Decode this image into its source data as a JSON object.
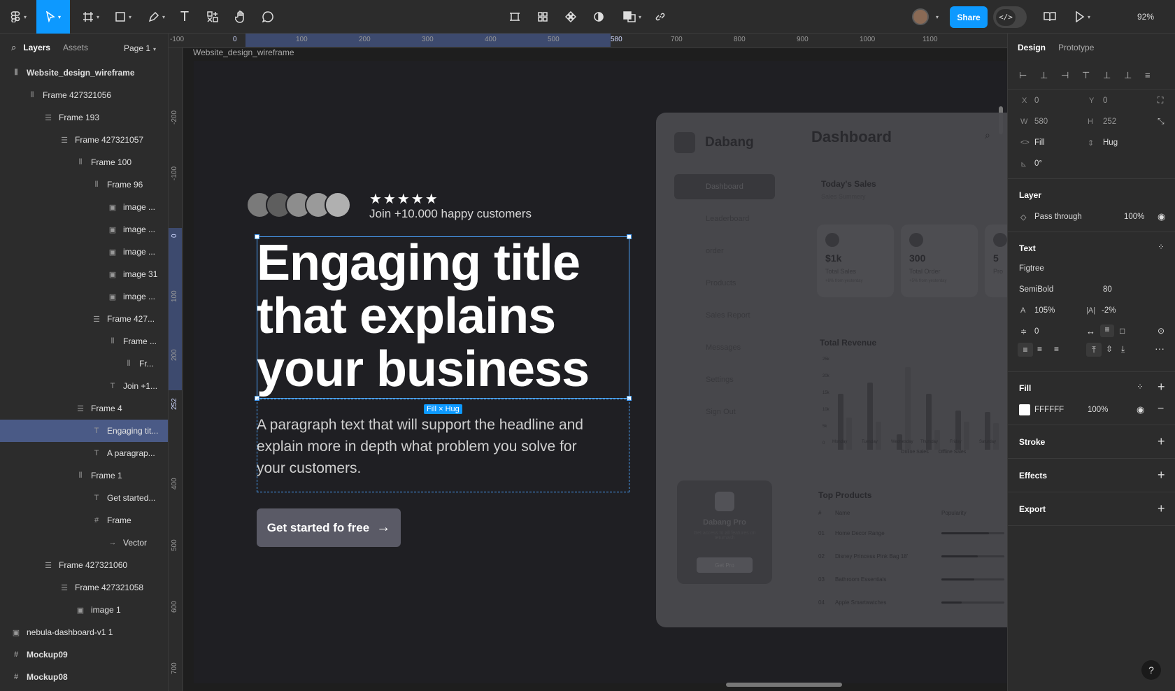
{
  "toolbar": {
    "share_label": "Share",
    "dev_mode_label": "</>",
    "zoom": "92%"
  },
  "left_panel": {
    "tabs": [
      "Layers",
      "Assets"
    ],
    "page": "Page 1",
    "layers": [
      {
        "name": "Website_design_wireframe",
        "indent": 0,
        "icon": "frame-vertical-icon",
        "bold": true
      },
      {
        "name": "Frame 427321056",
        "indent": 1,
        "icon": "frame-vertical-icon"
      },
      {
        "name": "Frame 193",
        "indent": 2,
        "icon": "frame-horizontal-icon"
      },
      {
        "name": "Frame 427321057",
        "indent": 3,
        "icon": "frame-horizontal-icon"
      },
      {
        "name": "Frame 100",
        "indent": 4,
        "icon": "frame-vertical-icon"
      },
      {
        "name": "Frame 96",
        "indent": 5,
        "icon": "frame-vertical-icon"
      },
      {
        "name": "image ...",
        "indent": 6,
        "icon": "image-icon"
      },
      {
        "name": "image ...",
        "indent": 6,
        "icon": "image-icon"
      },
      {
        "name": "image ...",
        "indent": 6,
        "icon": "image-icon"
      },
      {
        "name": "image 31",
        "indent": 6,
        "icon": "image-icon"
      },
      {
        "name": "image ...",
        "indent": 6,
        "icon": "image-icon"
      },
      {
        "name": "Frame 427...",
        "indent": 5,
        "icon": "frame-horizontal-icon"
      },
      {
        "name": "Frame ...",
        "indent": 6,
        "icon": "frame-vertical-icon"
      },
      {
        "name": "Fr...",
        "indent": 7,
        "icon": "frame-vertical-icon"
      },
      {
        "name": "Join +1...",
        "indent": 6,
        "icon": "text-icon"
      },
      {
        "name": "Frame 4",
        "indent": 4,
        "icon": "frame-horizontal-icon"
      },
      {
        "name": "Engaging tit...",
        "indent": 5,
        "icon": "text-icon",
        "selected": true
      },
      {
        "name": "A paragrap...",
        "indent": 5,
        "icon": "text-icon"
      },
      {
        "name": "Frame 1",
        "indent": 4,
        "icon": "frame-vertical-icon"
      },
      {
        "name": "Get started...",
        "indent": 5,
        "icon": "text-icon"
      },
      {
        "name": "Frame",
        "indent": 5,
        "icon": "hash-icon"
      },
      {
        "name": "Vector",
        "indent": 6,
        "icon": "arrow-icon"
      },
      {
        "name": "Frame 427321060",
        "indent": 2,
        "icon": "frame-horizontal-icon"
      },
      {
        "name": "Frame 427321058",
        "indent": 3,
        "icon": "frame-horizontal-icon"
      },
      {
        "name": "image 1",
        "indent": 4,
        "icon": "image-icon"
      },
      {
        "name": "nebula-dashboard-v1 1",
        "indent": 0,
        "icon": "image-icon"
      },
      {
        "name": "Mockup09",
        "indent": 0,
        "icon": "hash-icon",
        "bold": true
      },
      {
        "name": "Mockup08",
        "indent": 0,
        "icon": "hash-icon",
        "bold": true
      }
    ]
  },
  "rulers": {
    "top": [
      "-100",
      "0",
      "100",
      "200",
      "300",
      "400",
      "500",
      "580",
      "700",
      "800",
      "900",
      "1000",
      "1100"
    ],
    "left": [
      "-200",
      "-100",
      "0",
      "100",
      "200",
      "252",
      "400",
      "500",
      "600",
      "700"
    ]
  },
  "canvas": {
    "frame_name": "Website_design_wireframe",
    "stars": "★★★★★",
    "join_text": "Join +10.000 happy customers",
    "headline_lines": [
      "Engaging title",
      "that explains",
      "your business"
    ],
    "size_badge": "Fill × Hug",
    "paragraph": "A paragraph text that will support the headline and explain more in depth what problem you solve for your customers.",
    "cta_label": "Get started fo free",
    "cta_arrow": "→",
    "mockup": {
      "brand": "Dabang",
      "title": "Dashboard",
      "nav": [
        "Dashboard",
        "Leaderboard",
        "order",
        "Products",
        "Sales Report",
        "Messages",
        "Settings",
        "Sign Out"
      ],
      "todays_sales": "Today's Sales",
      "sales_summary": "Sales Summery",
      "cards": [
        {
          "value": "$1k",
          "label": "Total Sales",
          "sub": "+8% from yesterday"
        },
        {
          "value": "300",
          "label": "Total Order",
          "sub": "+5% from yesterday"
        },
        {
          "value": "5",
          "label": "Pro",
          "sub": ""
        }
      ],
      "total_revenue": "Total Revenue",
      "revenue_days": [
        "Monday",
        "Tuesday",
        "Wednesday",
        "Thursday",
        "Friday",
        "Saturday"
      ],
      "revenue_y_ticks": [
        "25k",
        "20k",
        "15k",
        "10k",
        "5k",
        "0"
      ],
      "revenue_legend": [
        "Online Sales",
        "Offline Sales"
      ],
      "promo_title": "Dabang Pro",
      "promo_text": "Get access to all features on tetumash",
      "promo_btn": "Get Pro",
      "top_products": "Top Products",
      "top_products_headers": [
        "#",
        "Name",
        "Popularity"
      ],
      "products": [
        {
          "n": "01",
          "name": "Home Decor Range"
        },
        {
          "n": "02",
          "name": "Disney Princess Pink Bag 18'"
        },
        {
          "n": "03",
          "name": "Bathroom Essentials"
        },
        {
          "n": "04",
          "name": "Apple Smartwatches"
        }
      ]
    }
  },
  "right_panel": {
    "tabs": [
      "Design",
      "Prototype"
    ],
    "position": {
      "x_label": "X",
      "x": "0",
      "y_label": "Y",
      "y": "0",
      "w_label": "W",
      "w": "580",
      "h_label": "H",
      "h": "252",
      "fill_mode": "Fill",
      "hug_mode": "Hug",
      "rotation": "0°"
    },
    "layer": {
      "title": "Layer",
      "blend": "Pass through",
      "opacity": "100%"
    },
    "text": {
      "title": "Text",
      "font": "Figtree",
      "weight": "SemiBold",
      "size": "80",
      "line_height": "105%",
      "letter_spacing": "-2%",
      "paragraph_spacing": "0"
    },
    "fill": {
      "title": "Fill",
      "color": "FFFFFF",
      "opacity": "100%",
      "swatch": "#FFFFFF"
    },
    "stroke_title": "Stroke",
    "effects_title": "Effects",
    "export_title": "Export"
  },
  "help_label": "?",
  "colors": {
    "accent": "#0d99ff",
    "selection": "#4aa3ff",
    "layer_selected": "#4a5a86"
  }
}
